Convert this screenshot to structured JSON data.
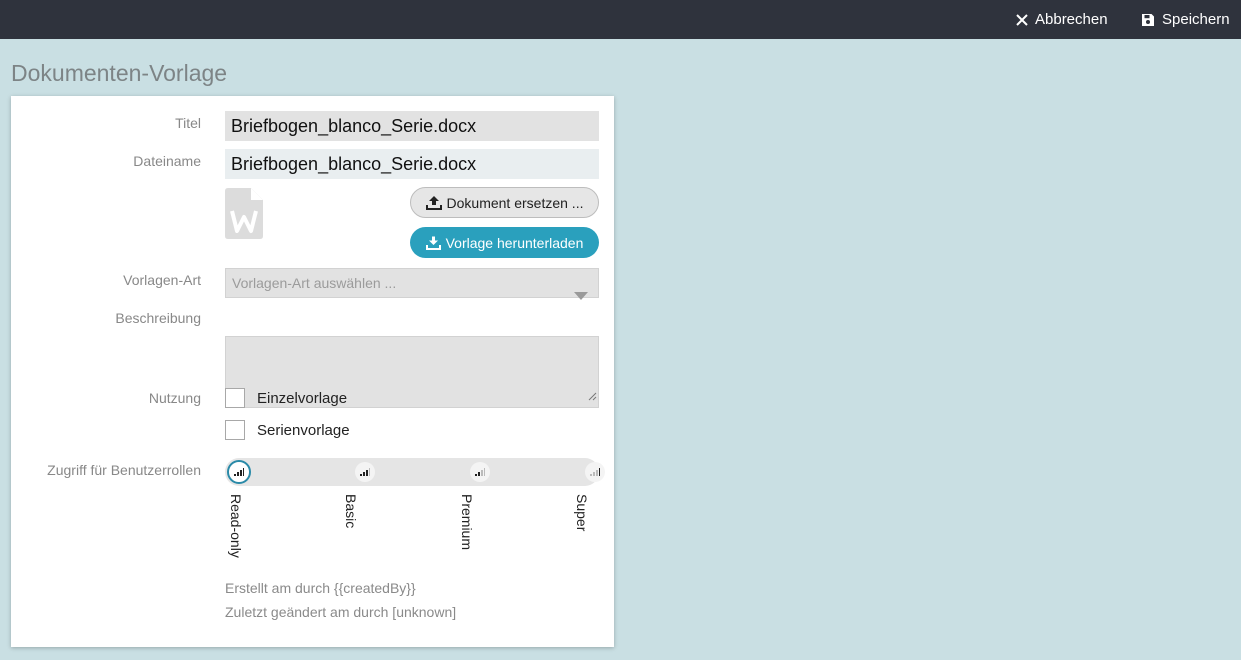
{
  "toolbar": {
    "cancel_label": "Abbrechen",
    "save_label": "Speichern",
    "cancel_icon": "close-icon",
    "save_icon": "floppy-disk-icon"
  },
  "page": {
    "title": "Dokumenten-Vorlage"
  },
  "form": {
    "title_label": "Titel",
    "title_value": "Briefbogen_blanco_Serie.docx",
    "filename_label": "Dateiname",
    "filename_value": "Briefbogen_blanco_Serie.docx",
    "file_icon": "word-document-icon",
    "replace_button": "Dokument ersetzen ...",
    "download_button": "Vorlage herunterladen",
    "type_label": "Vorlagen-Art",
    "type_placeholder": "Vorlagen-Art auswählen ...",
    "description_label": "Beschreibung",
    "description_value": "",
    "usage_label": "Nutzung",
    "usage_options": [
      {
        "label": "Einzelvorlage",
        "checked": false
      },
      {
        "label": "Serienvorlage",
        "checked": false
      }
    ],
    "access_label": "Zugriff für Benutzerrollen",
    "roles": [
      "Read-only",
      "Basic",
      "Premium",
      "Super"
    ],
    "selected_role": "Read-only",
    "created_text": "Erstellt am durch {{createdBy}}",
    "modified_text": "Zuletzt geändert am durch [unknown]"
  },
  "colors": {
    "topbar": "#2f333d",
    "background": "#c9dfe3",
    "accent": "#2aa0bd"
  }
}
